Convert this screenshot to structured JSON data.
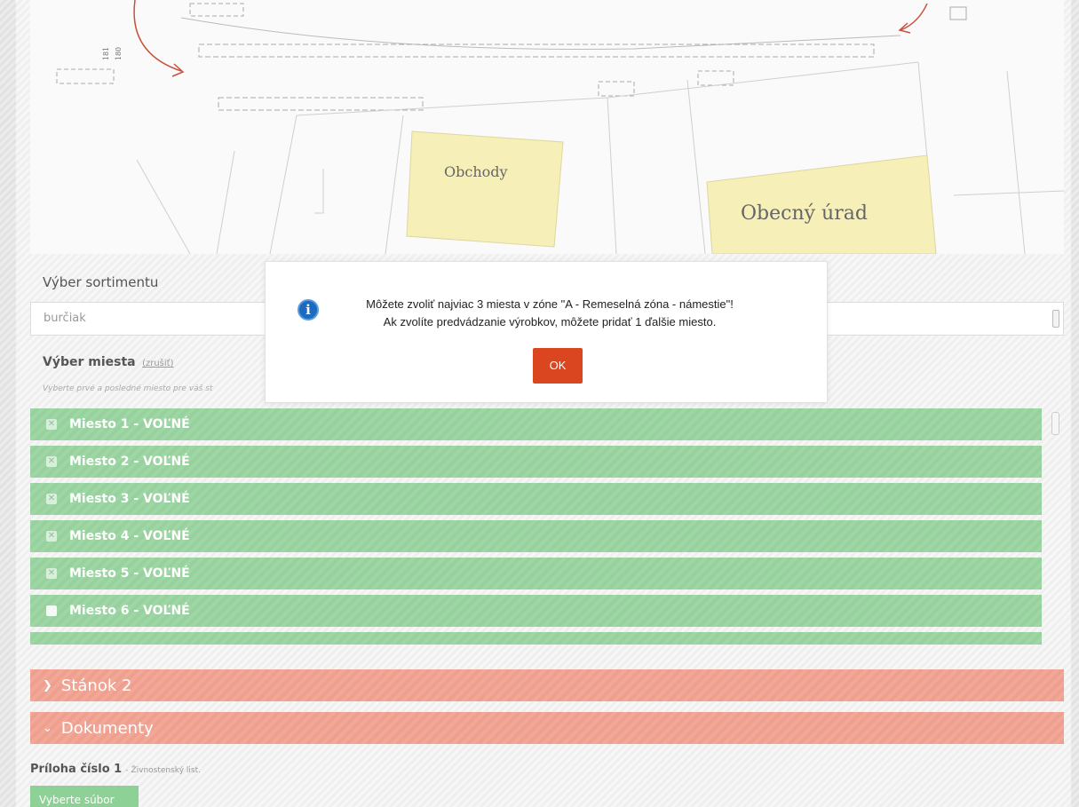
{
  "map": {
    "labels": [
      "Obchody",
      "Obecný úrad"
    ],
    "stall_numbers": [
      "181",
      "180"
    ]
  },
  "sortiment": {
    "label": "Výber sortimentu",
    "value": "burčiak"
  },
  "miesto": {
    "label": "Výber miesta",
    "clear_link": "(zrušiť)",
    "hint": "Vyberte prvé a posledné miesto pre váš st"
  },
  "places": [
    {
      "label": "Miesto 1 - VOĽNÉ",
      "checked": true
    },
    {
      "label": "Miesto 2 - VOĽNÉ",
      "checked": true
    },
    {
      "label": "Miesto 3 - VOĽNÉ",
      "checked": true
    },
    {
      "label": "Miesto 4 - VOĽNÉ",
      "checked": true
    },
    {
      "label": "Miesto 5 - VOĽNÉ",
      "checked": true
    },
    {
      "label": "Miesto 6 - VOĽNÉ",
      "checked": false
    }
  ],
  "accordions": {
    "stanok2": "Stánok 2",
    "dokumenty": "Dokumenty"
  },
  "priloha": {
    "title": "Príloha číslo 1",
    "subtitle": "- Živnostenský list.",
    "button": "Vyberte súbor"
  },
  "dialog": {
    "line1": "Môžete zvoliť najviac 3 miesta v zóne \"A - Remeselná zóna - námestie\"!",
    "line2": "Ak zvolíte predvádzanie výrobkov, môžete pridať 1 ďalšie miesto.",
    "ok_label": "OK"
  },
  "colors": {
    "place_free": "#9fd6a6",
    "accordion": "#f2a898",
    "ok_button": "#d9461f",
    "map_building": "#f6f0b8"
  }
}
